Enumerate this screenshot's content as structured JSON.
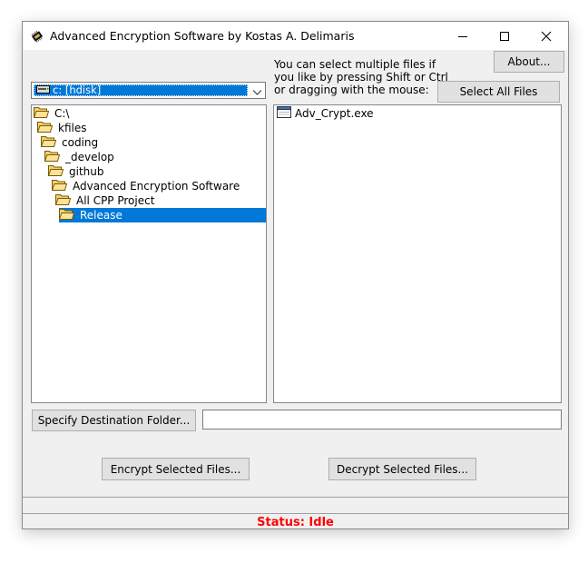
{
  "window": {
    "title": "Advanced Encryption Software by Kostas A. Delimaris",
    "minimize_label": "minimize",
    "maximize_label": "maximize",
    "close_label": "close"
  },
  "about_button": "About...",
  "hint_text": "You can select multiple files if\nyou like by pressing Shift or Ctrl\nor dragging with the mouse:",
  "select_all_button": "Select All Files",
  "drive": {
    "selected": "c: [hdisk]"
  },
  "folders": [
    {
      "label": "C:\\",
      "open": true,
      "selected": false
    },
    {
      "label": "kfiles",
      "open": true,
      "selected": false
    },
    {
      "label": "coding",
      "open": true,
      "selected": false
    },
    {
      "label": "_develop",
      "open": true,
      "selected": false
    },
    {
      "label": "github",
      "open": true,
      "selected": false
    },
    {
      "label": "Advanced Encryption Software",
      "open": true,
      "selected": false
    },
    {
      "label": "All CPP Project",
      "open": true,
      "selected": false
    },
    {
      "label": "Release",
      "open": true,
      "selected": true
    }
  ],
  "files": [
    {
      "name": "Adv_Crypt.exe"
    }
  ],
  "dest_button": "Specify Destination Folder...",
  "dest_value": "",
  "encrypt_button": "Encrypt Selected Files...",
  "decrypt_button": "Decrypt Selected Files...",
  "status": "Status: Idle",
  "colors": {
    "status": "#ff0000",
    "selection": "#0078d7"
  }
}
